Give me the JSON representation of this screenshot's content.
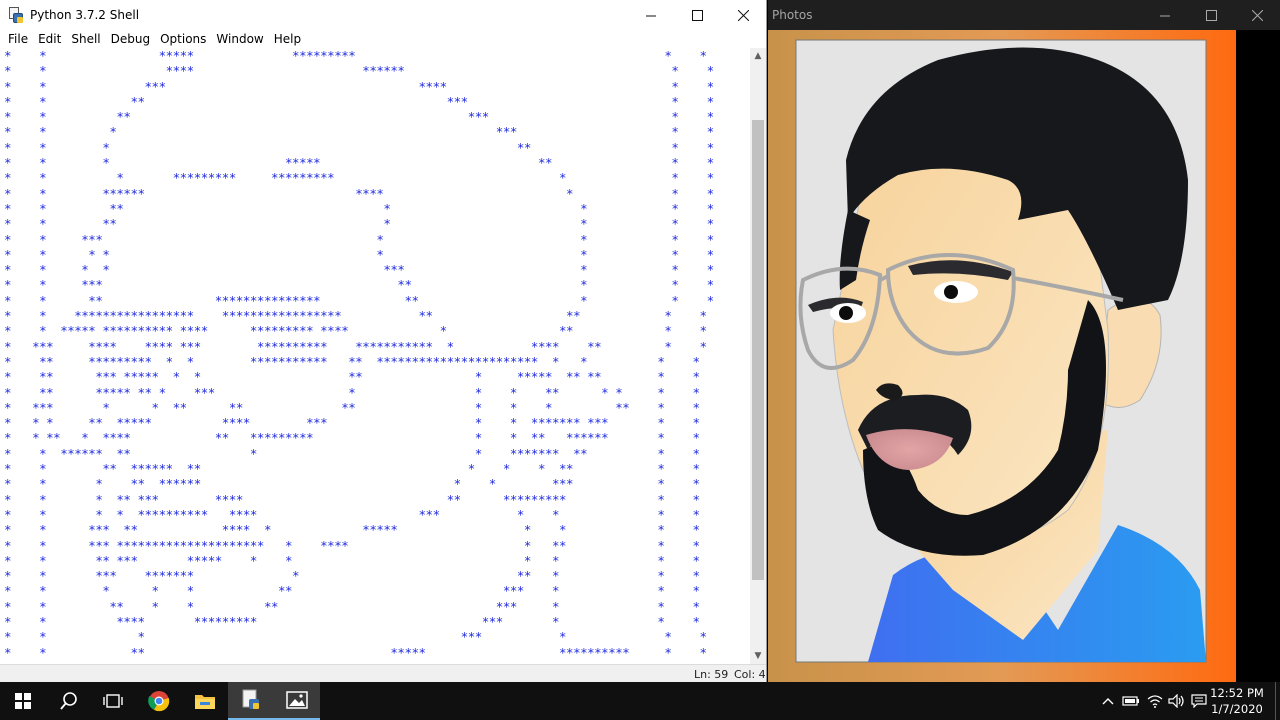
{
  "shell": {
    "title": "Python 3.7.2 Shell",
    "menu": [
      "File",
      "Edit",
      "Shell",
      "Debug",
      "Options",
      "Window",
      "Help"
    ],
    "output_lines": [
      "*    *                *****              *********                                            *    *",
      "*    *                 ****                        ******                                      *    *",
      "*    *              ***                                    ****                                *    *",
      "*    *            **                                           ***                             *    *",
      "*    *          **                                                ***                          *    *",
      "*    *         *                                                      ***                      *    *",
      "*    *        *                                                          **                    *    *",
      "*    *        *                         *****                               **                 *    *",
      "*    *          *       *********     *********                                *               *    *",
      "*    *        ******                              ****                          *              *    *",
      "*    *         **                                     *                           *            *    *",
      "*    *        **                                      *                           *            *    *",
      "*    *     ***                                       *                            *            *    *",
      "*    *      * *                                      *                            *            *    *",
      "*    *     *  *                                       ***                         *            *    *",
      "*    *     ***                                          **                        *            *    *",
      "*    *      **                ***************            **                       *            *    *",
      "*    *    *****************    *****************           **                   **            *    *",
      "*    *  ***** ********** ****      ********* ****             *                **             *    *",
      "*   ***     ****    **** ***        **********    ***********  *           ****    **         *    *",
      "*    **     *********  *  *        ***********   **  ***********************  *   *          *    *",
      "*    **      *** *****  *  *                     **                *     *****  ** **        *    *",
      "*    **      ***** ** *    ***                   *                 *    *    **      * *     *    *",
      "*   ***       *      *  **      **              **                 *    *    *         **    *    *",
      "*   * *     **  *****          ****        ***                     *    *  ******* ***       *    *",
      "*   * **   *  ****            **   *********                       *    *  **   ******       *    *",
      "*    *  ******  **                 *                               *    *******  **          *    *",
      "*    *        **  ******  **                                      *    *    *  **            *    *",
      "*    *       *    **  ******                                    *    *        ***            *    *",
      "*    *       *  ** ***        ****                             **      *********             *    *",
      "*    *       *  *  **********   ****                       ***           *    *              *    *",
      "*    *      ***  **            ****  *             *****                  *    *             *    *",
      "*    *      *** *********************   *    ****                         *   **             *    *",
      "*    *       ** ***       *****    *    *                                 *   *              *    *",
      "*    *       ***    *******              *                               **   *              *    *",
      "*    *        *      *    *            **                              ***    *              *    *",
      "*    *         **    *    *          **                               ***     *              *    *",
      "*    *          ****       *********                                ***       *              *    *",
      "*    *             *                                             ***           *              *    *",
      "*    *            **                                   *****                   **********     *    *",
      "*    *              ***               *********                                 *        ***   *    *"
    ],
    "status": {
      "line": "Ln: 59",
      "col": "Col: 4"
    },
    "icons": {
      "logo": "python-shell-icon",
      "minimize": "minimize-icon",
      "maximize": "maximize-icon",
      "close": "close-icon"
    }
  },
  "photos": {
    "title": "Photos",
    "image_description": "cartoon-portrait-man-with-beard-and-glasses"
  },
  "taskbar": {
    "apps": [
      "start-icon",
      "search-icon",
      "task-view-icon",
      "chrome-icon",
      "file-explorer-icon",
      "python-idle-icon",
      "photos-icon"
    ],
    "tray": [
      "chevron-up-icon",
      "battery-icon",
      "wifi-icon",
      "volume-icon",
      "notification-icon"
    ],
    "time": "12:52 PM",
    "date": "1/7/2020"
  },
  "colors": {
    "shell_text": "#1f2be0",
    "photos_bg": "#1f1f1f",
    "taskbar": "#101010",
    "accent": "#76b9ed"
  }
}
